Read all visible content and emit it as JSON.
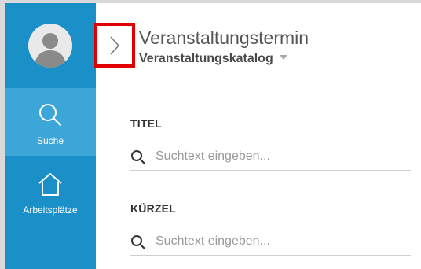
{
  "sidebar": {
    "items": [
      {
        "label": "Suche",
        "icon": "search-icon"
      },
      {
        "label": "Arbeitsplätze",
        "icon": "home-icon"
      }
    ]
  },
  "header": {
    "title": "Veranstaltungstermin",
    "catalog_select": "Veranstaltungskatalog"
  },
  "fields": [
    {
      "label": "TITEL",
      "placeholder": "Suchtext eingeben..."
    },
    {
      "label": "KÜRZEL",
      "placeholder": "Suchtext eingeben..."
    }
  ],
  "colors": {
    "sidebar": "#1a8fc8",
    "sidebar_active": "#3da6d9",
    "highlight_border": "#e00000"
  }
}
